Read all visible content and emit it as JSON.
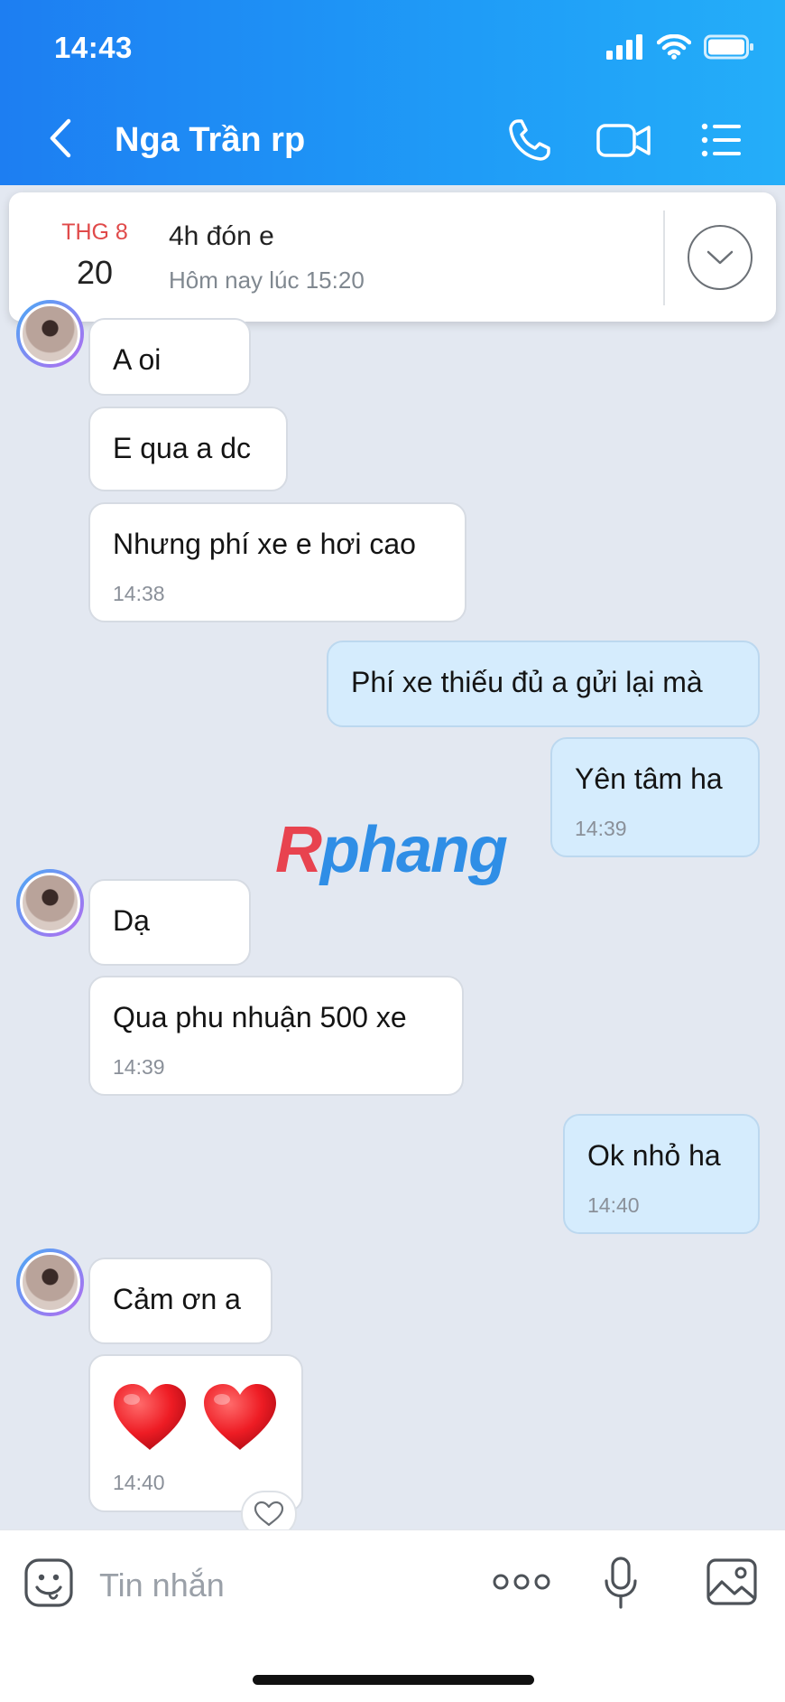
{
  "status_bar": {
    "time": "14:43"
  },
  "header": {
    "title": "Nga Trần rp"
  },
  "reminder": {
    "month": "THG 8",
    "day": "20",
    "title": "4h đón e",
    "subtitle": "Hôm nay lúc 15:20"
  },
  "messages": [
    {
      "side": "in",
      "text": "A oi"
    },
    {
      "side": "in",
      "text": "E qua a dc"
    },
    {
      "side": "in",
      "text": "Nhưng phí xe e hơi cao",
      "time": "14:38"
    },
    {
      "side": "out",
      "text": "Phí xe thiếu đủ a gửi lại mà"
    },
    {
      "side": "out",
      "text": "Yên tâm ha",
      "time": "14:39"
    },
    {
      "side": "in",
      "text": "Dạ"
    },
    {
      "side": "in",
      "text": "Qua phu nhuận 500 xe",
      "time": "14:39"
    },
    {
      "side": "out",
      "text": "Ok nhỏ ha",
      "time": "14:40"
    },
    {
      "side": "in",
      "text": "Cảm ơn a"
    },
    {
      "side": "in",
      "text": "❤️❤️",
      "time": "14:40"
    }
  ],
  "watermark": {
    "first": "R",
    "rest": "phang"
  },
  "input": {
    "placeholder": "Tin nhắn"
  },
  "colors": {
    "header": "#1f8ff5",
    "incoming_bubble": "#ffffff",
    "outgoing_bubble": "#d5ecfd",
    "background": "#e3e8f1"
  }
}
